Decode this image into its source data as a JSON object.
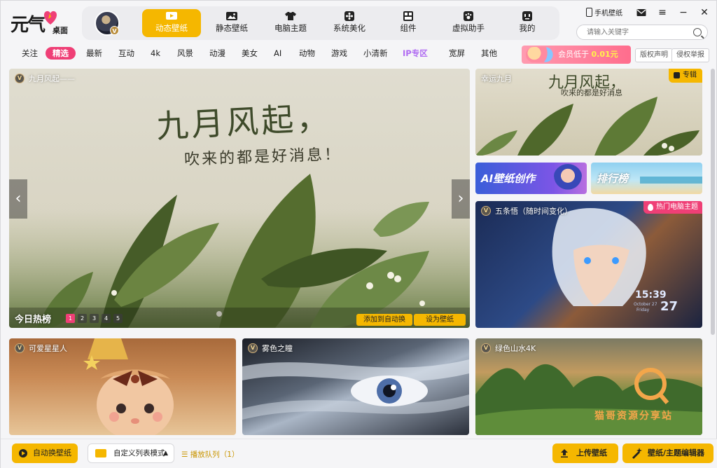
{
  "app": {
    "logo_text": "元气",
    "logo_sub": "桌面"
  },
  "nav": {
    "tabs": [
      {
        "label": "动态壁纸",
        "icon": "play-screen-icon",
        "active": true
      },
      {
        "label": "静态壁纸",
        "icon": "image-icon",
        "active": false
      },
      {
        "label": "电脑主题",
        "icon": "shirt-icon",
        "active": false
      },
      {
        "label": "系统美化",
        "icon": "flower-icon",
        "active": false
      },
      {
        "label": "组件",
        "icon": "widget-icon",
        "active": false
      },
      {
        "label": "虚拟助手",
        "icon": "paw-icon",
        "active": false
      },
      {
        "label": "我的",
        "icon": "profile-icon",
        "active": false
      }
    ],
    "avatar_badge": "V"
  },
  "topbar": {
    "phone_wallpaper": "手机壁纸",
    "search_placeholder": "请输入关键字"
  },
  "categories": {
    "items": [
      "关注",
      "精选",
      "最新",
      "互动",
      "4k",
      "风景",
      "动漫",
      "美女",
      "AI",
      "动物",
      "游戏",
      "小清新",
      "IP专区",
      "宽屏",
      "其他"
    ],
    "active": "精选",
    "promo_prefix": "会员低于",
    "promo_price": "0.01元",
    "copyright_label": "版权声明",
    "report_label": "侵权举报"
  },
  "hero": {
    "tag": "九月风起——",
    "heading": "九月风起，",
    "subheading": "吹来的都是好消息！",
    "section_label": "今日热榜",
    "dots": [
      "1",
      "2",
      "3",
      "4",
      "5"
    ],
    "active_dot": "1",
    "add_auto_label": "添加到自动换",
    "set_wallpaper_label": "设为壁纸",
    "prev": "‹",
    "next": "›"
  },
  "side": {
    "lucky_tag": "幸运九月",
    "lucky_heading": "九月风起，",
    "lucky_sub": "吹来的都是好消息",
    "album_badge": "专辑",
    "ai_label": "AI壁纸创作",
    "rank_label": "排行榜",
    "gojo_tag": "五条悟（随时间变化）",
    "hot_badge": "热门电脑主题",
    "clock_time": "15:39",
    "clock_date": "27",
    "clock_month": "October 27",
    "clock_day": "Friday"
  },
  "thumbs": [
    {
      "tag": "可爱星星人"
    },
    {
      "tag": "雾色之瞳"
    },
    {
      "tag": "绿色山水4K",
      "watermark": "猫哥资源分享站"
    }
  ],
  "footer": {
    "auto_change": "自动换壁纸",
    "list_mode": "自定义列表模式",
    "queue": "播放队列（1）",
    "upload": "上传壁纸",
    "editor": "壁纸/主题编辑器"
  },
  "colors": {
    "accent": "#f5b700",
    "pink": "#ef3f76",
    "ip_purple": "#b06cf2"
  }
}
